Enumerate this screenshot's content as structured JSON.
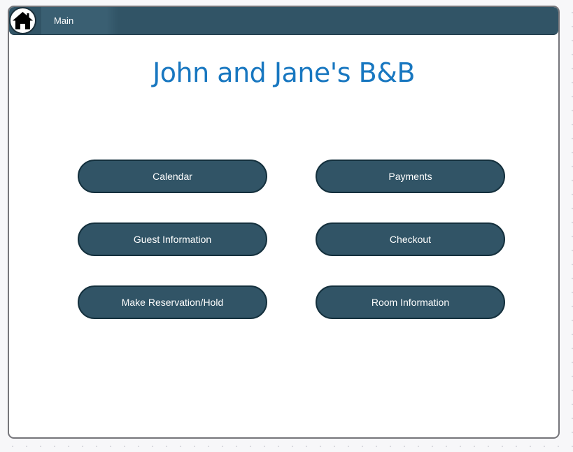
{
  "header": {
    "home_icon": "home-icon",
    "tab_label": "Main"
  },
  "main": {
    "title": "John and Jane's B&B",
    "buttons": {
      "calendar": "Calendar",
      "payments": "Payments",
      "guest_information": "Guest Information",
      "checkout": "Checkout",
      "make_reservation": "Make Reservation/Hold",
      "room_information": "Room Information"
    }
  },
  "colors": {
    "header_bg": "#315466",
    "button_bg": "#315466",
    "title_color": "#1877c0",
    "window_bg": "#ffffff"
  }
}
